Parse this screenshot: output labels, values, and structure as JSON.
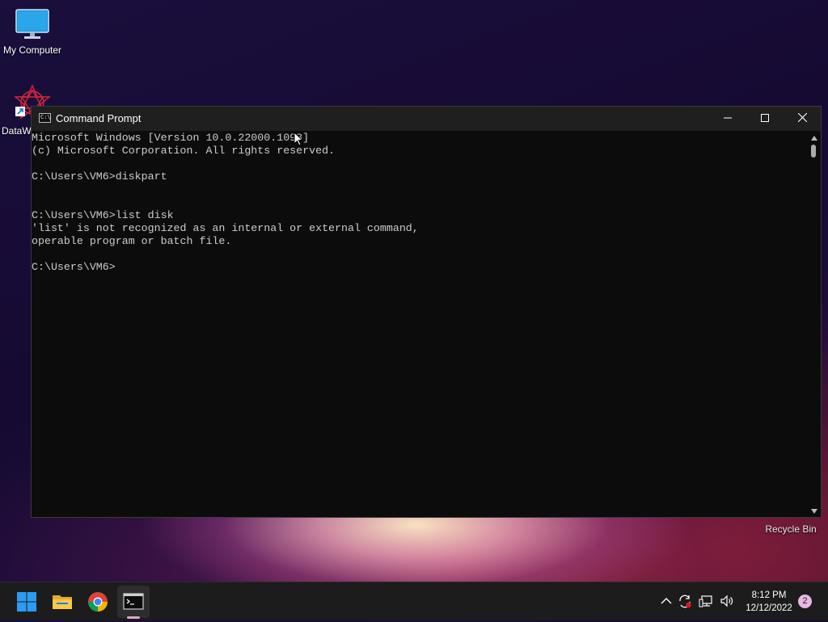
{
  "desktop": {
    "icons": [
      {
        "label": "My Computer",
        "icon": "monitor-icon"
      },
      {
        "label": "DataW",
        "icon": "datawarrior-shortcut-icon"
      },
      {
        "label": "Recycle Bin",
        "icon": "recycle-bin-icon"
      }
    ]
  },
  "window": {
    "title": "Command Prompt",
    "icon": "cmd-icon",
    "controls": {
      "minimize": "minimize-icon",
      "maximize": "maximize-icon",
      "close": "close-icon"
    }
  },
  "console": {
    "lines": [
      "Microsoft Windows [Version 10.0.22000.1098]",
      "(c) Microsoft Corporation. All rights reserved.",
      "",
      "C:\\Users\\VM6>diskpart",
      "",
      "",
      "C:\\Users\\VM6>list disk",
      "'list' is not recognized as an internal or external command,",
      "operable program or batch file.",
      "",
      "C:\\Users\\VM6>"
    ]
  },
  "taskbar": {
    "apps": [
      {
        "name": "Start",
        "icon": "windows-start-icon"
      },
      {
        "name": "File Explorer",
        "icon": "folder-icon"
      },
      {
        "name": "Google Chrome",
        "icon": "chrome-icon"
      },
      {
        "name": "Command Prompt",
        "icon": "cmd-icon",
        "active": true
      }
    ],
    "tray": {
      "icons": [
        "chevron-up-icon",
        "sync-icon",
        "network-icon",
        "volume-icon"
      ],
      "time": "8:12 PM",
      "date": "12/12/2022",
      "notification_count": "2"
    }
  },
  "colors": {
    "console_bg": "#0c0c0c",
    "console_text": "#cccccc",
    "titlebar": "#1f1f1f",
    "taskbar": "#1c1c1c",
    "accent": "#0078d4"
  }
}
